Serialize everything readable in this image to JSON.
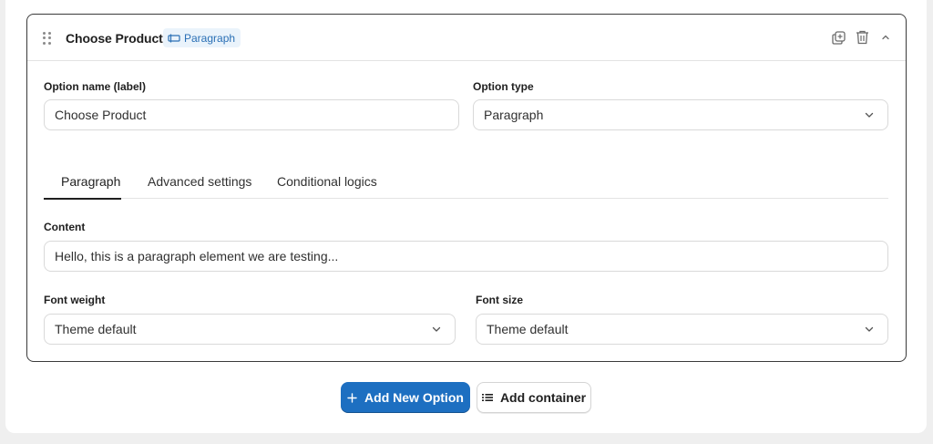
{
  "option": {
    "title": "Choose Product",
    "type_badge": "Paragraph"
  },
  "fields": {
    "option_name_label": "Option name (label)",
    "option_name_value": "Choose Product",
    "option_type_label": "Option type",
    "option_type_value": "Paragraph"
  },
  "tabs": [
    {
      "label": "Paragraph",
      "active": true
    },
    {
      "label": "Advanced settings",
      "active": false
    },
    {
      "label": "Conditional logics",
      "active": false
    }
  ],
  "content": {
    "label": "Content",
    "value": "Hello, this is a paragraph element we are testing..."
  },
  "font_weight": {
    "label": "Font weight",
    "value": "Theme default"
  },
  "font_size": {
    "label": "Font size",
    "value": "Theme default"
  },
  "actions": {
    "add_option": "Add New Option",
    "add_container": "Add container"
  },
  "icons": {
    "drag": "drag-handle-icon",
    "badge": "paragraph-icon",
    "duplicate": "duplicate-icon",
    "delete": "trash-icon",
    "collapse": "chevron-up-icon",
    "plus": "plus-icon",
    "list": "list-icon"
  },
  "colors": {
    "primary": "#1d6fc1",
    "badge_bg": "#eaf3fb",
    "badge_text": "#2a6fb5"
  }
}
